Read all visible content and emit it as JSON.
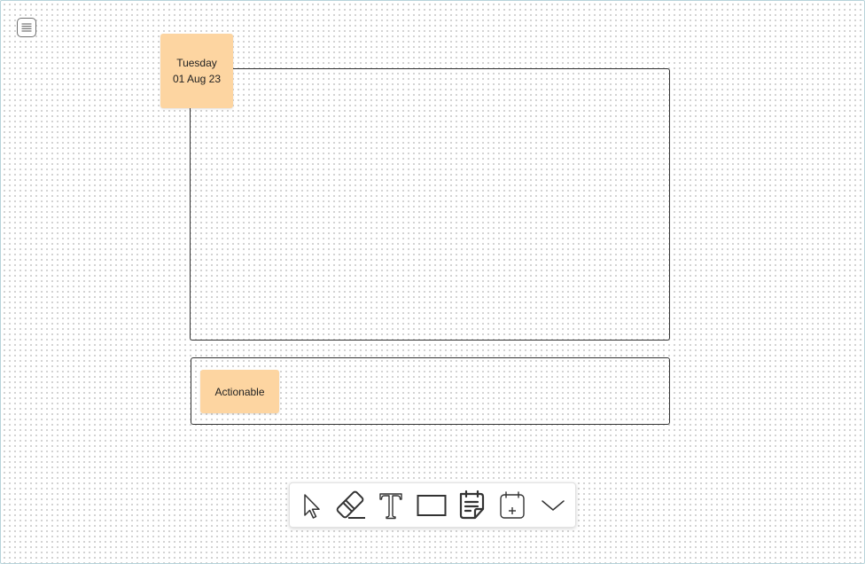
{
  "menu": {
    "icon": "hamburger-icon"
  },
  "board": {
    "date_note": {
      "day": "Tuesday",
      "date": "01 Aug 23",
      "color": "#fdd5a1"
    },
    "actionable_note": {
      "label": "Actionable",
      "color": "#fdd5a1"
    }
  },
  "toolbar": {
    "tools": [
      {
        "name": "select",
        "icon": "cursor-icon"
      },
      {
        "name": "eraser",
        "icon": "eraser-icon"
      },
      {
        "name": "text",
        "icon": "text-icon"
      },
      {
        "name": "rectangle",
        "icon": "rectangle-icon"
      },
      {
        "name": "sticky-note",
        "icon": "sticky-note-icon"
      },
      {
        "name": "add-date",
        "icon": "calendar-add-icon"
      },
      {
        "name": "more",
        "icon": "chevron-down-icon"
      }
    ]
  }
}
